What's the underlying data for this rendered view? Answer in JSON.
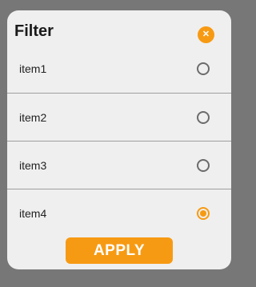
{
  "dialog": {
    "title": "Filter",
    "close_icon": "close-icon",
    "items": [
      {
        "label": "item1",
        "selected": false
      },
      {
        "label": "item2",
        "selected": false
      },
      {
        "label": "item3",
        "selected": false
      },
      {
        "label": "item4",
        "selected": true
      }
    ],
    "apply_label": "APPLY"
  },
  "colors": {
    "accent": "#f79a13",
    "dialog_bg": "#efefef",
    "backdrop": "#777777"
  }
}
